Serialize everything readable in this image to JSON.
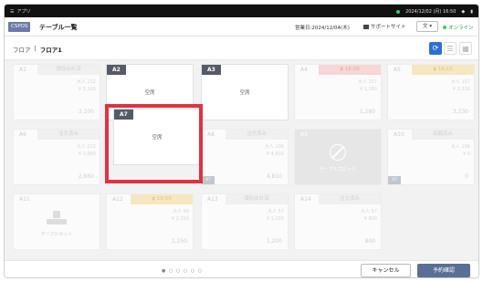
{
  "statusbar": {
    "app_label": "アプリ",
    "datetime": "2024/12/02 (月) 16:50",
    "icons": [
      "menu-icon",
      "wifi-icon",
      "battery-icon"
    ]
  },
  "header": {
    "brand": "CSPOS",
    "title": "テーブル一覧",
    "business_date": "営業日:2024/12/04(木)",
    "support": "サポートサイト",
    "lang": "文 ▾",
    "online": "オンライン"
  },
  "floor": {
    "crumb_parent": "フロア",
    "crumb_sep": "|",
    "crumb_current": "フロア1"
  },
  "tables": [
    {
      "name": "A1",
      "status": "領収合計済",
      "meta1": "大人 212",
      "meta2": "¥ 3,100",
      "amount": "3,100"
    },
    {
      "name": "A2",
      "center": "空席"
    },
    {
      "name": "A3",
      "center": "空席"
    },
    {
      "name": "A4",
      "status": "16:50",
      "meta1": "大人 157",
      "meta2": "¥ 1,280",
      "amount": "1,280"
    },
    {
      "name": "A5",
      "status": "16:15",
      "meta1": "大人 157",
      "meta2": "¥ 3,330",
      "amount": "3,330"
    },
    {
      "name": "A6",
      "status": "注文済み",
      "meta1": "大人 212",
      "meta2": "¥ 2,660",
      "amount": "2,660"
    },
    {
      "name": "A7",
      "center": "空席"
    },
    {
      "name": "A8",
      "status": "注文済み",
      "meta1": "大人 106",
      "meta2": "¥ 4,810",
      "amount": "4,810",
      "foot": "47"
    },
    {
      "name": "A9",
      "lock_label": "テーブルブロック"
    },
    {
      "name": "A10",
      "status": "高額済み",
      "meta1": "大人 106",
      "meta2": "¥ 0",
      "amount": "0",
      "foot": "47"
    },
    {
      "name": "A11",
      "seat_label": "テーブルセット"
    },
    {
      "name": "A12",
      "status": "16:50",
      "meta1": "大人 99",
      "meta2": "¥ 2,250",
      "amount": "2,250"
    },
    {
      "name": "A13",
      "status": "領収合計済",
      "meta1": "大人 57",
      "meta2": "¥ 1,200",
      "amount": "1,200"
    },
    {
      "name": "A14",
      "status": "注文済み",
      "meta1": "大人 57",
      "meta2": "¥ 800",
      "amount": "800"
    }
  ],
  "pager": "● ○ ○ ○ ○ ○",
  "buttons": {
    "cancel": "キャンセル",
    "confirm": "予約確認"
  },
  "colors": {
    "accent": "#2f6fd0",
    "highlight": "#e0323f",
    "button": "#5a6f96"
  }
}
